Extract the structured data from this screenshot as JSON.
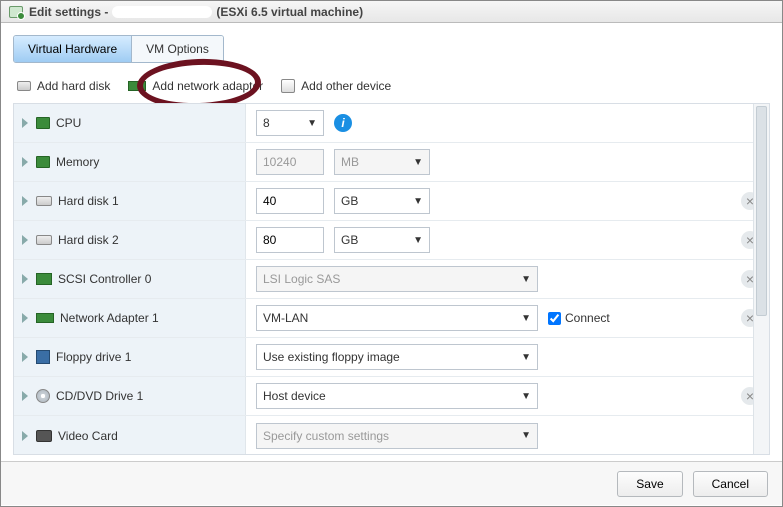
{
  "title": {
    "prefix": "Edit settings -",
    "suffix": "(ESXi 6.5 virtual machine)"
  },
  "tabs": {
    "hardware": "Virtual Hardware",
    "options": "VM Options"
  },
  "toolbar": {
    "add_hd": "Add hard disk",
    "add_na": "Add network adapter",
    "add_other": "Add other device"
  },
  "rows": {
    "cpu": {
      "label": "CPU",
      "value": "8"
    },
    "memory": {
      "label": "Memory",
      "value": "10240",
      "unit": "MB"
    },
    "hdd1": {
      "label": "Hard disk 1",
      "value": "40",
      "unit": "GB"
    },
    "hdd2": {
      "label": "Hard disk 2",
      "value": "80",
      "unit": "GB"
    },
    "scsi": {
      "label": "SCSI Controller 0",
      "value": "LSI Logic SAS"
    },
    "nic1": {
      "label": "Network Adapter 1",
      "value": "VM-LAN",
      "connect": "Connect"
    },
    "floppy": {
      "label": "Floppy drive 1",
      "value": "Use existing floppy image"
    },
    "cddvd": {
      "label": "CD/DVD Drive 1",
      "value": "Host device"
    },
    "video": {
      "label": "Video Card",
      "value": "Specify custom settings"
    }
  },
  "footer": {
    "save": "Save",
    "cancel": "Cancel"
  }
}
